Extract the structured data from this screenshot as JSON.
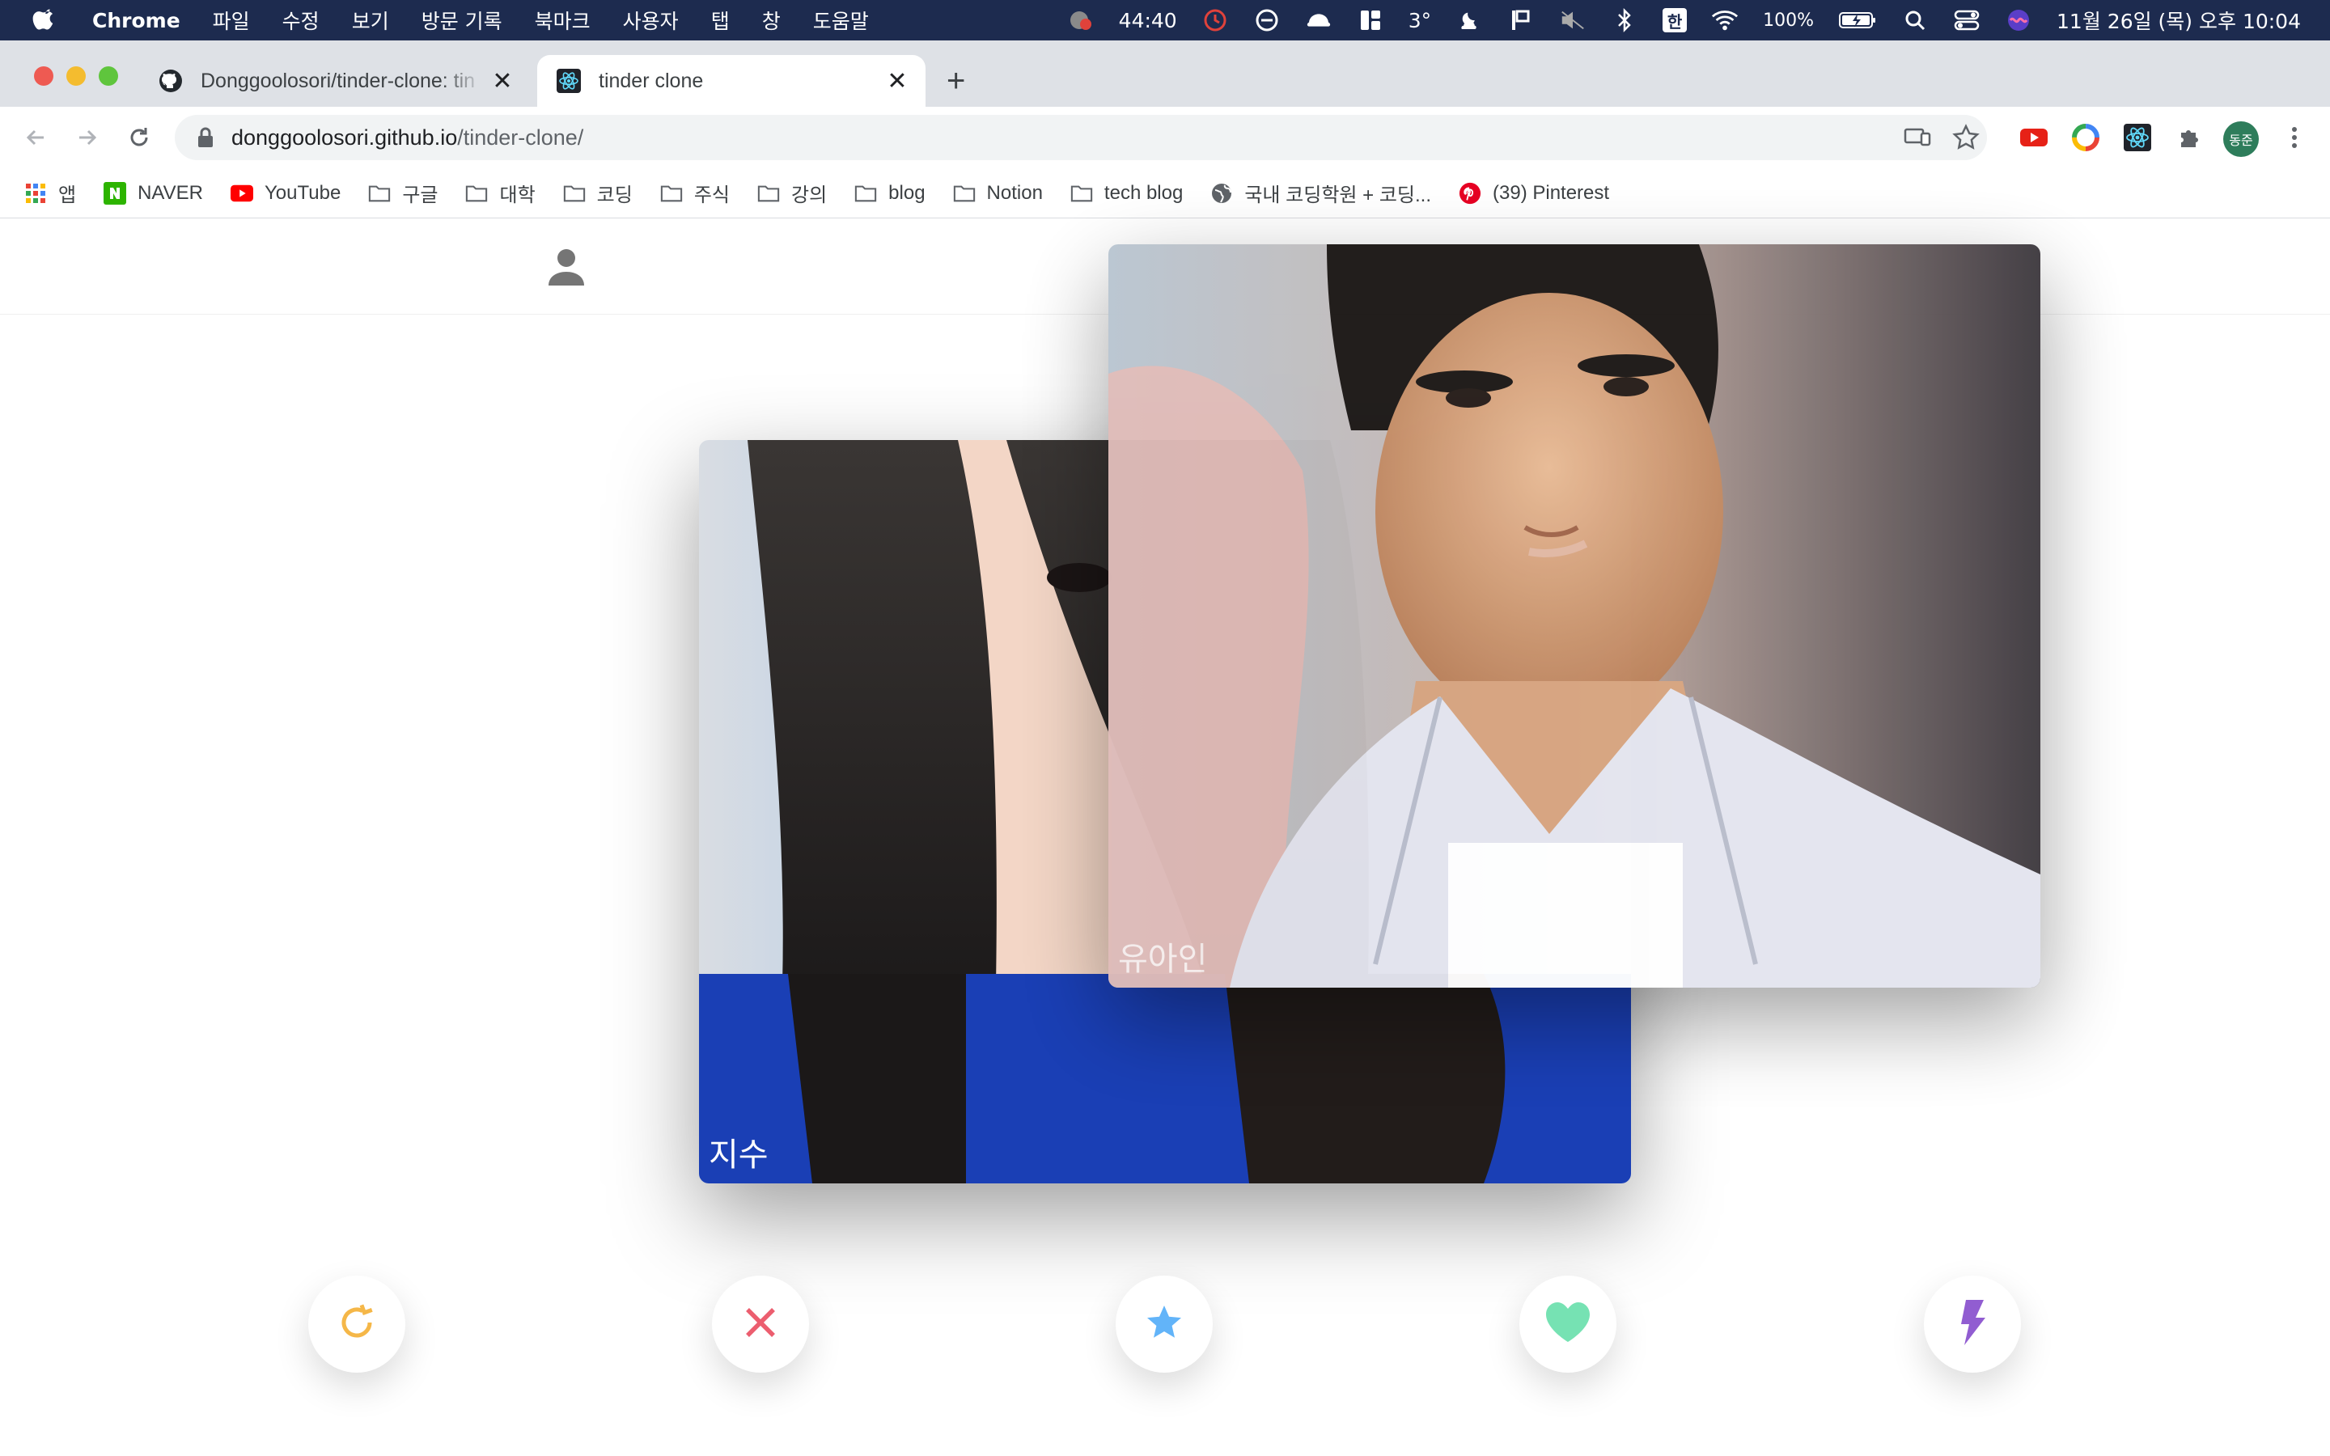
{
  "menubar": {
    "app_name": "Chrome",
    "items": [
      "파일",
      "수정",
      "보기",
      "방문 기록",
      "북마크",
      "사용자",
      "탭",
      "창",
      "도움말"
    ],
    "timer": "44:40",
    "weather": "3°",
    "input_method": "한",
    "battery": "100%",
    "datetime": "11월 26일 (목) 오후 10:04"
  },
  "tabs": [
    {
      "title": "Donggoolosori/tinder-clone: tin",
      "icon": "github-icon",
      "active": false
    },
    {
      "title": "tinder clone",
      "icon": "react-icon",
      "active": true
    }
  ],
  "omnibox": {
    "host": "donggoolosori.github.io",
    "path": "/tinder-clone/"
  },
  "bookmarks": [
    {
      "label": "앱",
      "icon": "apps-grid-icon"
    },
    {
      "label": "NAVER",
      "icon": "naver-icon"
    },
    {
      "label": "YouTube",
      "icon": "youtube-icon"
    },
    {
      "label": "구글",
      "icon": "folder-icon"
    },
    {
      "label": "대학",
      "icon": "folder-icon"
    },
    {
      "label": "코딩",
      "icon": "folder-icon"
    },
    {
      "label": "주식",
      "icon": "folder-icon"
    },
    {
      "label": "강의",
      "icon": "folder-icon"
    },
    {
      "label": "blog",
      "icon": "folder-icon"
    },
    {
      "label": "Notion",
      "icon": "folder-icon"
    },
    {
      "label": "tech blog",
      "icon": "folder-icon"
    },
    {
      "label": "국내 코딩학원 + 코딩...",
      "icon": "globe-icon"
    },
    {
      "label": "(39) Pinterest",
      "icon": "pinterest-icon"
    }
  ],
  "profile": {
    "initials": "동준"
  },
  "cards": [
    {
      "name": "지수"
    },
    {
      "name": "유아인"
    }
  ],
  "actions": [
    {
      "name": "replay",
      "color": "#f5b748"
    },
    {
      "name": "close",
      "color": "#ec5e6f"
    },
    {
      "name": "star",
      "color": "#62b4f9"
    },
    {
      "name": "heart",
      "color": "#76e2b3"
    },
    {
      "name": "flash",
      "color": "#915dd1"
    }
  ]
}
